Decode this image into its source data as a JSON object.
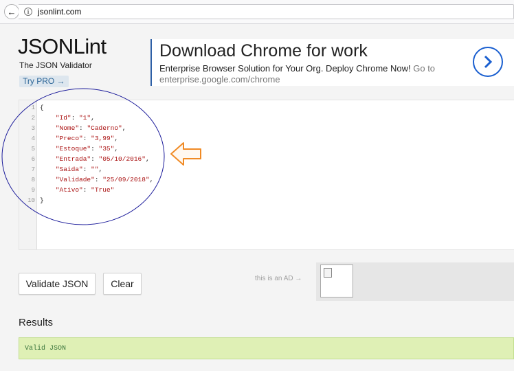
{
  "browser": {
    "back_glyph": "←",
    "info_glyph": "i",
    "url": "jsonlint.com"
  },
  "header": {
    "title": "JSONLint",
    "subtitle": "The JSON Validator",
    "try_pro_label": "Try PRO →"
  },
  "ad": {
    "headline": "Download Chrome for work",
    "description": "Enterprise Browser Solution for Your Org. Deploy Chrome Now!",
    "link_text": "Go to enterprise.google.com/chrome",
    "accent_color": "#1a5fd0"
  },
  "editor": {
    "line_numbers": [
      "1",
      "2",
      "3",
      "4",
      "5",
      "6",
      "7",
      "8",
      "9",
      "10"
    ],
    "lines": [
      {
        "indent": "",
        "key": "",
        "value": "",
        "raw": "{"
      },
      {
        "indent": "    ",
        "key": "\"Id\"",
        "value": "\"1\"",
        "raw": ""
      },
      {
        "indent": "    ",
        "key": "\"Nome\"",
        "value": "\"Caderno\"",
        "raw": ""
      },
      {
        "indent": "    ",
        "key": "\"Preco\"",
        "value": "\"3,99\"",
        "raw": ""
      },
      {
        "indent": "    ",
        "key": "\"Estoque\"",
        "value": "\"35\"",
        "raw": ""
      },
      {
        "indent": "    ",
        "key": "\"Entrada\"",
        "value": "\"05/10/2016\"",
        "raw": ""
      },
      {
        "indent": "    ",
        "key": "\"Saida\"",
        "value": "\"\"",
        "raw": ""
      },
      {
        "indent": "    ",
        "key": "\"Validade\"",
        "value": "\"25/09/2018\"",
        "raw": ""
      },
      {
        "indent": "    ",
        "key": "\"Ativo\"",
        "value": "\"True\"",
        "raw": ""
      },
      {
        "indent": "",
        "key": "",
        "value": "",
        "raw": "}"
      }
    ]
  },
  "actions": {
    "validate_label": "Validate JSON",
    "clear_label": "Clear",
    "ad_label": "this is an AD →"
  },
  "results": {
    "heading": "Results",
    "message": "Valid JSON",
    "status_color": "#dff0b5"
  },
  "annotations": {
    "circle_color": "#1a1a9a",
    "arrow_color": "#f08a24"
  }
}
